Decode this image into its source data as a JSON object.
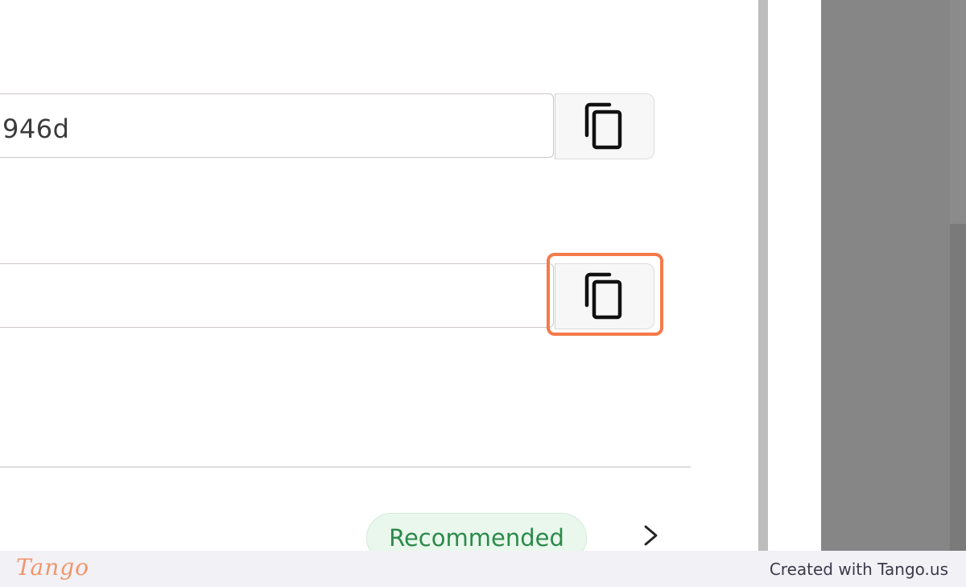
{
  "form": {
    "field1_value": "946d",
    "field2_value": "",
    "copy_icon": "copy-icon"
  },
  "list": {
    "badge_label": "Recommended",
    "chevron_icon": "chevron-right-icon"
  },
  "footer": {
    "brand": "Tango",
    "credit": "Created with Tango.us"
  },
  "colors": {
    "highlight": "#f47a4a",
    "badge_bg": "#e9f7ec",
    "badge_text": "#2c8a4b",
    "overlay": "#868686"
  }
}
